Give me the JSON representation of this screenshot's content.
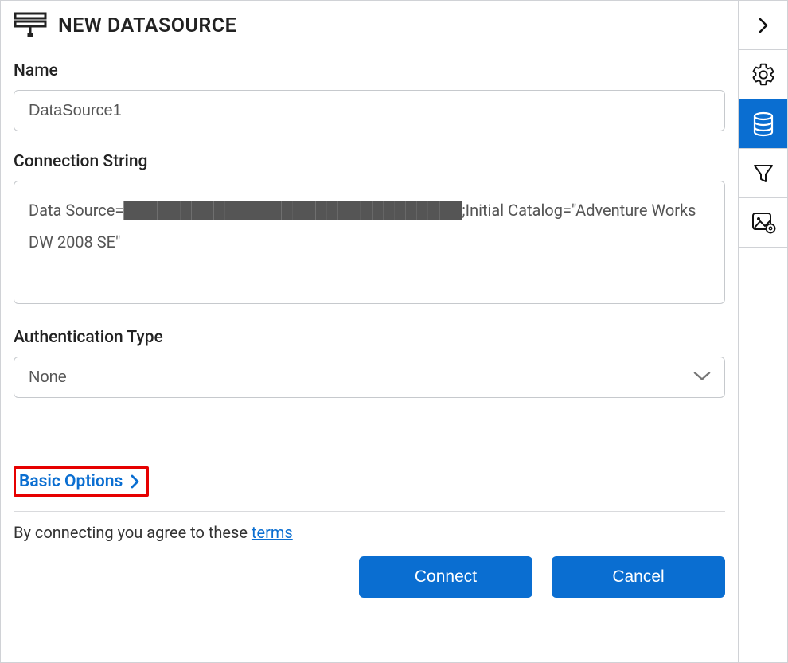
{
  "page_title": "NEW DATASOURCE",
  "fields": {
    "name": {
      "label": "Name",
      "value": "DataSource1"
    },
    "connection_string": {
      "label": "Connection String",
      "value": "Data Source=██████████████████████████████;Initial Catalog=\"Adventure Works DW 2008 SE\""
    },
    "auth_type": {
      "label": "Authentication Type",
      "value": "None"
    }
  },
  "basic_options_label": "Basic Options",
  "terms_text_prefix": "By connecting you agree to these ",
  "terms_link_text": "terms",
  "actions": {
    "connect": "Connect",
    "cancel": "Cancel"
  },
  "sidebar": {
    "items": [
      {
        "name": "expand",
        "interactive": true
      },
      {
        "name": "settings",
        "interactive": true
      },
      {
        "name": "datasources-active",
        "interactive": true,
        "active": true
      },
      {
        "name": "filter",
        "interactive": true
      },
      {
        "name": "image-settings",
        "interactive": true
      }
    ]
  },
  "colors": {
    "primary": "#0a6ed1",
    "highlight_border": "#e60000"
  }
}
